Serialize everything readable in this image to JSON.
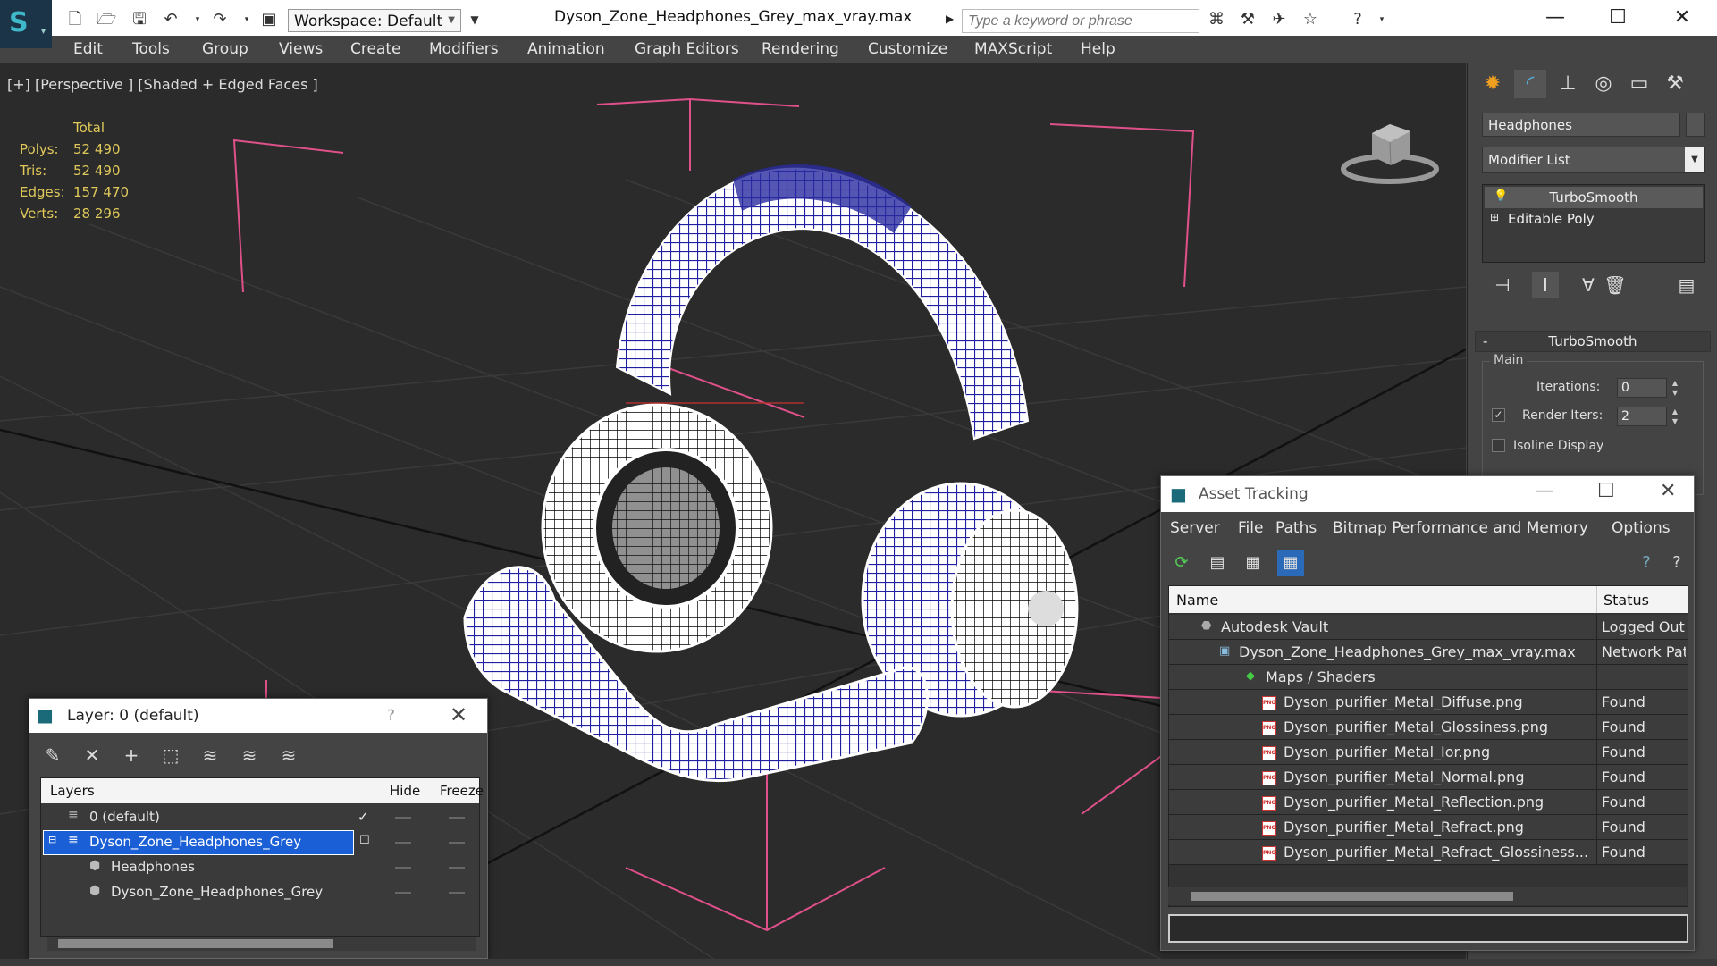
{
  "titlebar": {
    "workspace": "Workspace: Default",
    "document_title": "Dyson_Zone_Headphones_Grey_max_vray.max",
    "search_placeholder": "Type a keyword or phrase"
  },
  "menu": [
    "Edit",
    "Tools",
    "Group",
    "Views",
    "Create",
    "Modifiers",
    "Animation",
    "Graph Editors",
    "Rendering",
    "Customize",
    "MAXScript",
    "Help"
  ],
  "viewport": {
    "label": "[+] [Perspective ] [Shaded + Edged Faces ]",
    "stats": {
      "header": "Total",
      "rows": [
        {
          "label": "Polys:",
          "value": "52 490"
        },
        {
          "label": "Tris:",
          "value": "52 490"
        },
        {
          "label": "Edges:",
          "value": "157 470"
        },
        {
          "label": "Verts:",
          "value": "28 296"
        }
      ]
    },
    "wire_color": "#2a2aa0"
  },
  "command_panel": {
    "object_name": "Headphones",
    "modifier_list": "Modifier List",
    "stack": [
      "TurboSmooth",
      "Editable Poly"
    ],
    "turbosmooth": {
      "title": "TurboSmooth",
      "group": "Main",
      "iterations_label": "Iterations:",
      "iterations_value": "0",
      "render_iters_label": "Render Iters:",
      "render_iters_value": "2",
      "render_iters_checked": true,
      "isoline_label": "Isoline Display",
      "isoline_checked": false
    }
  },
  "layer_window": {
    "title": "Layer: 0 (default)",
    "help": "?",
    "columns": {
      "layers": "Layers",
      "hide": "Hide",
      "freeze": "Freeze"
    },
    "rows": [
      {
        "name": "0 (default)",
        "level": 0,
        "current": true,
        "selected": false
      },
      {
        "name": "Dyson_Zone_Headphones_Grey",
        "level": 0,
        "current": false,
        "selected": true
      },
      {
        "name": "Headphones",
        "level": 1,
        "current": false,
        "selected": false
      },
      {
        "name": "Dyson_Zone_Headphones_Grey",
        "level": 1,
        "current": false,
        "selected": false
      }
    ],
    "selected_color": "#1b5fd6"
  },
  "asset_window": {
    "title": "Asset Tracking",
    "menu": [
      "Server",
      "File",
      "Paths",
      "Bitmap Performance and Memory",
      "Options"
    ],
    "columns": {
      "name": "Name",
      "status": "Status"
    },
    "rows": [
      {
        "name": "Autodesk Vault",
        "status": "Logged Out",
        "level": 0,
        "icon": "vault-icon"
      },
      {
        "name": "Dyson_Zone_Headphones_Grey_max_vray.max",
        "status": "Network Path",
        "level": 1,
        "icon": "max-file-icon"
      },
      {
        "name": "Maps / Shaders",
        "status": "",
        "level": 2,
        "icon": "maps-icon"
      },
      {
        "name": "Dyson_purifier_Metal_Diffuse.png",
        "status": "Found",
        "level": 3,
        "icon": "png-icon"
      },
      {
        "name": "Dyson_purifier_Metal_Glossiness.png",
        "status": "Found",
        "level": 3,
        "icon": "png-icon"
      },
      {
        "name": "Dyson_purifier_Metal_Ior.png",
        "status": "Found",
        "level": 3,
        "icon": "png-icon"
      },
      {
        "name": "Dyson_purifier_Metal_Normal.png",
        "status": "Found",
        "level": 3,
        "icon": "png-icon"
      },
      {
        "name": "Dyson_purifier_Metal_Reflection.png",
        "status": "Found",
        "level": 3,
        "icon": "png-icon"
      },
      {
        "name": "Dyson_purifier_Metal_Refract.png",
        "status": "Found",
        "level": 3,
        "icon": "png-icon"
      },
      {
        "name": "Dyson_purifier_Metal_Refract_Glossiness...",
        "status": "Found",
        "level": 3,
        "icon": "png-icon"
      }
    ]
  }
}
